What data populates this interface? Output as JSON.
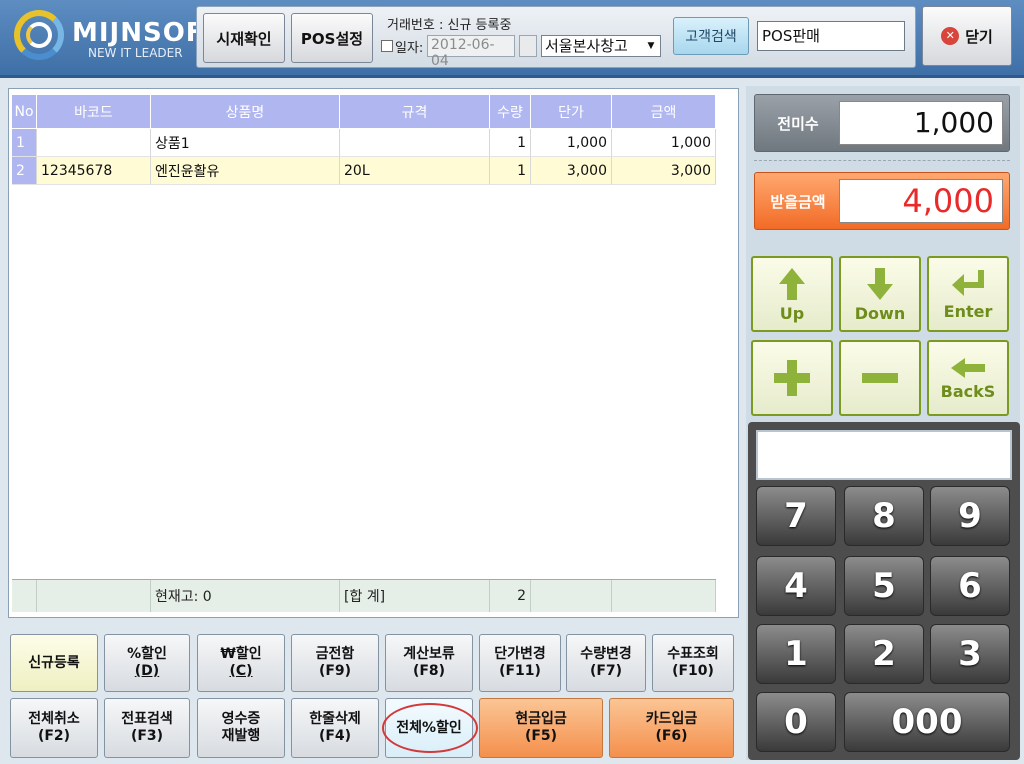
{
  "app": {
    "logo_name": "MIJNSOFT",
    "logo_tagline": "NEW IT LEADER"
  },
  "toolbar": {
    "cash_check_label": "시재확인",
    "pos_settings_label": "POS설정",
    "transaction_info": "거래번호 : 신규 등록중",
    "date_label": "일자:",
    "date_value": "2012-06-04",
    "warehouse_value": "서울본사창고",
    "customer_search_label": "고객검색",
    "pos_mode_value": "POS판매",
    "close_label": "닫기"
  },
  "grid": {
    "columns": [
      "No",
      "바코드",
      "상품명",
      "규격",
      "수량",
      "단가",
      "금액"
    ],
    "rows": [
      {
        "no": "1",
        "barcode": "",
        "name": "상품1",
        "spec": "",
        "qty": "1",
        "price": "1,000",
        "amount": "1,000"
      },
      {
        "no": "2",
        "barcode": "12345678",
        "name": "엔진윤활유",
        "spec": "20L",
        "qty": "1",
        "price": "3,000",
        "amount": "3,000"
      }
    ],
    "footer": {
      "stock": "현재고: 0",
      "total_label": "[합 계]",
      "total_qty": "2"
    }
  },
  "actions": {
    "row1": [
      {
        "label": "신규등록",
        "sub": ""
      },
      {
        "label": "%할인",
        "sub": "(D)"
      },
      {
        "label": "₩할인",
        "sub": "(C)"
      },
      {
        "label": "금전함",
        "sub": "(F9)"
      },
      {
        "label": "계산보류",
        "sub": "(F8)"
      },
      {
        "label": "단가변경",
        "sub": "(F11)"
      },
      {
        "label": "수량변경",
        "sub": "(F7)"
      },
      {
        "label": "수표조회",
        "sub": "(F10)"
      }
    ],
    "row2": [
      {
        "label": "전체취소",
        "sub": "(F2)"
      },
      {
        "label": "전표검색",
        "sub": "(F3)"
      },
      {
        "label": "영수증",
        "sub": "재발행"
      },
      {
        "label": "한줄삭제",
        "sub": "(F4)"
      },
      {
        "label": "전체%할인",
        "sub": ""
      },
      {
        "label": "현금입금",
        "sub": "(F5)"
      },
      {
        "label": "카드입금",
        "sub": "(F6)"
      }
    ]
  },
  "summary": {
    "previous_unpaid_label": "전미수",
    "previous_unpaid_value": "1,000",
    "amount_due_label": "받을금액",
    "amount_due_value": "4,000"
  },
  "nav": {
    "up_label": "Up",
    "down_label": "Down",
    "enter_label": "Enter",
    "backspace_label": "BackS"
  },
  "keypad": {
    "keys": [
      "7",
      "8",
      "9",
      "4",
      "5",
      "6",
      "1",
      "2",
      "3",
      "0",
      "000"
    ]
  },
  "colors": {
    "header_blue": "#4a7bb3",
    "grid_header": "#b0b6ef",
    "selected_row": "#fffbd4",
    "amount_due": "#e82a2a",
    "orange_button": "#f4904d"
  }
}
